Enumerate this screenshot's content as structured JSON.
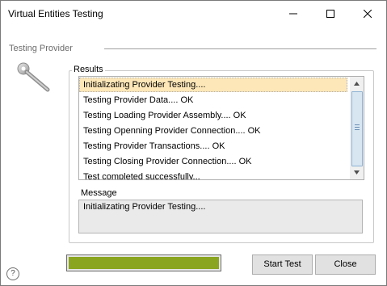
{
  "window": {
    "title": "Virtual Entities Testing"
  },
  "section": {
    "label": "Testing Provider"
  },
  "results": {
    "label": "Results",
    "items": [
      "Initializating Provider Testing....",
      "Testing Provider Data.... OK",
      "Testing Loading Provider Assembly.... OK",
      "Testing Openning Provider Connection.... OK",
      "Testing Provider Transactions.... OK",
      "Testing Closing Provider Connection.... OK",
      "Test completed successfully..."
    ],
    "selected_index": 0
  },
  "message": {
    "label": "Message",
    "value": "Initializating Provider Testing...."
  },
  "progress": {
    "fraction": 1.0,
    "color": "#8aa51f"
  },
  "buttons": {
    "start_test": "Start Test",
    "close": "Close"
  },
  "help": {
    "glyph": "?"
  },
  "icons": {
    "tool": "wrench-icon"
  }
}
